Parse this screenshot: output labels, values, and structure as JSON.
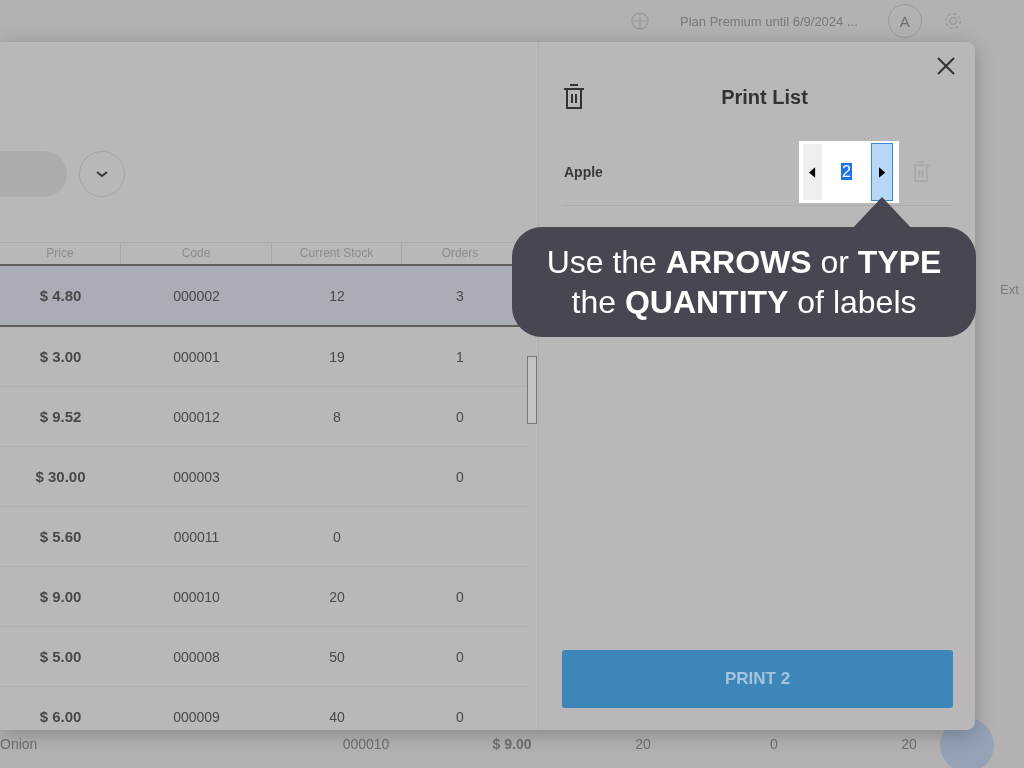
{
  "background": {
    "plan_text": "Plan Premium until 6/9/2024 ...",
    "avatar": "A",
    "column_label": "Ext",
    "row": [
      "Onion",
      "000010",
      "$ 9.00",
      "20",
      "0",
      "20"
    ]
  },
  "modal": {
    "table": {
      "columns": [
        "Price",
        "Code",
        "Current Stock",
        "Orders"
      ],
      "rows": [
        {
          "cells": [
            "$ 4.80",
            "000002",
            "12",
            "3"
          ],
          "selected": true
        },
        {
          "cells": [
            "$ 3.00",
            "000001",
            "19",
            "1"
          ],
          "selected": false
        },
        {
          "cells": [
            "$ 9.52",
            "000012",
            "8",
            "0"
          ],
          "selected": false
        },
        {
          "cells": [
            "$ 30.00",
            "000003",
            "",
            "0"
          ],
          "selected": false
        },
        {
          "cells": [
            "$ 5.60",
            "000011",
            "0",
            ""
          ],
          "selected": false
        },
        {
          "cells": [
            "$ 9.00",
            "000010",
            "20",
            "0"
          ],
          "selected": false
        },
        {
          "cells": [
            "$ 5.00",
            "000008",
            "50",
            "0"
          ],
          "selected": false
        },
        {
          "cells": [
            "$ 6.00",
            "000009",
            "40",
            "0"
          ],
          "selected": false
        }
      ]
    },
    "print_list": {
      "title": "Print List",
      "items": [
        {
          "name": "Apple",
          "quantity": "2"
        }
      ],
      "print_button": "PRINT 2"
    },
    "tooltip": "Use the **ARROWS** or **TYPE** the **QUANTITY** of labels"
  }
}
